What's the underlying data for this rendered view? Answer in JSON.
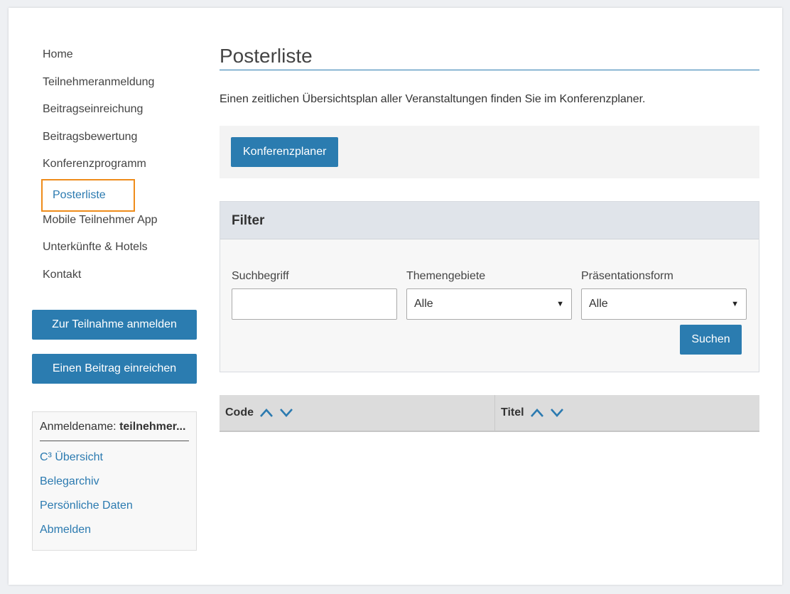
{
  "nav": {
    "items": [
      {
        "label": "Home"
      },
      {
        "label": "Teilnehmeranmeldung"
      },
      {
        "label": "Beitragseinreichung"
      },
      {
        "label": "Beitragsbewertung"
      },
      {
        "label": "Konferenzprogramm"
      },
      {
        "label": "Posterliste",
        "active": true
      },
      {
        "label": "Mobile Teilnehmer App"
      },
      {
        "label": "Unterkünfte & Hotels"
      },
      {
        "label": "Kontakt"
      }
    ]
  },
  "sidebar_buttons": {
    "register": "Zur Teilnahme anmelden",
    "submit": "Einen Beitrag einreichen"
  },
  "login": {
    "name_label": "Anmeldename:",
    "name_value": "teilnehmer...",
    "links": [
      "C³ Übersicht",
      "Belegarchiv",
      "Persönliche Daten",
      "Abmelden"
    ]
  },
  "main": {
    "title": "Posterliste",
    "intro": "Einen zeitlichen Übersichtsplan aller Veranstaltungen finden Sie im Konferenzplaner.",
    "planner_button": "Konferenzplaner"
  },
  "filter": {
    "heading": "Filter",
    "search_label": "Suchbegriff",
    "search_value": "",
    "topics_label": "Themengebiete",
    "topics_value": "Alle",
    "format_label": "Präsentationsform",
    "format_value": "Alle",
    "search_button": "Suchen"
  },
  "table": {
    "columns": [
      "Code",
      "Titel"
    ]
  },
  "colors": {
    "accent": "#2b7cb0",
    "active_border": "#ef8c1b"
  }
}
